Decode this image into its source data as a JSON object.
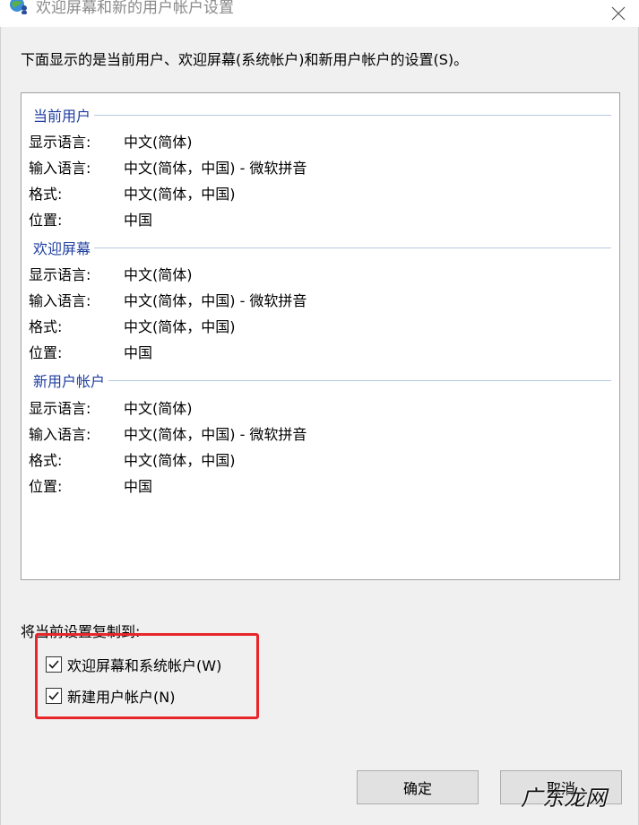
{
  "window": {
    "title": "欢迎屏幕和新的用户帐户设置",
    "icon": "globe-user-icon",
    "close_icon": "close-icon"
  },
  "description": "下面显示的是当前用户、欢迎屏幕(系统帐户)和新用户帐户的设置(S)。",
  "groups": [
    {
      "header": "当前用户",
      "rows": [
        {
          "label": "显示语言:",
          "value": "中文(简体)"
        },
        {
          "label": "输入语言:",
          "value": "中文(简体，中国) - 微软拼音"
        },
        {
          "label": "格式:",
          "value": "中文(简体，中国)"
        },
        {
          "label": "位置:",
          "value": "中国"
        }
      ]
    },
    {
      "header": "欢迎屏幕",
      "rows": [
        {
          "label": "显示语言:",
          "value": "中文(简体)"
        },
        {
          "label": "输入语言:",
          "value": "中文(简体，中国) - 微软拼音"
        },
        {
          "label": "格式:",
          "value": "中文(简体，中国)"
        },
        {
          "label": "位置:",
          "value": "中国"
        }
      ]
    },
    {
      "header": "新用户帐户",
      "rows": [
        {
          "label": "显示语言:",
          "value": "中文(简体)"
        },
        {
          "label": "输入语言:",
          "value": "中文(简体，中国) - 微软拼音"
        },
        {
          "label": "格式:",
          "value": "中文(简体，中国)"
        },
        {
          "label": "位置:",
          "value": "中国"
        }
      ]
    }
  ],
  "copy_settings": {
    "label": "将当前设置复制到:",
    "options": [
      {
        "label": "欢迎屏幕和系统帐户(W)",
        "checked": true
      },
      {
        "label": "新建用户帐户(N)",
        "checked": true
      }
    ]
  },
  "buttons": {
    "ok": "确定",
    "cancel": "取消"
  },
  "watermark": "广东龙网",
  "colors": {
    "group_header": "#1f3fa0",
    "highlight": "#e8262a"
  }
}
